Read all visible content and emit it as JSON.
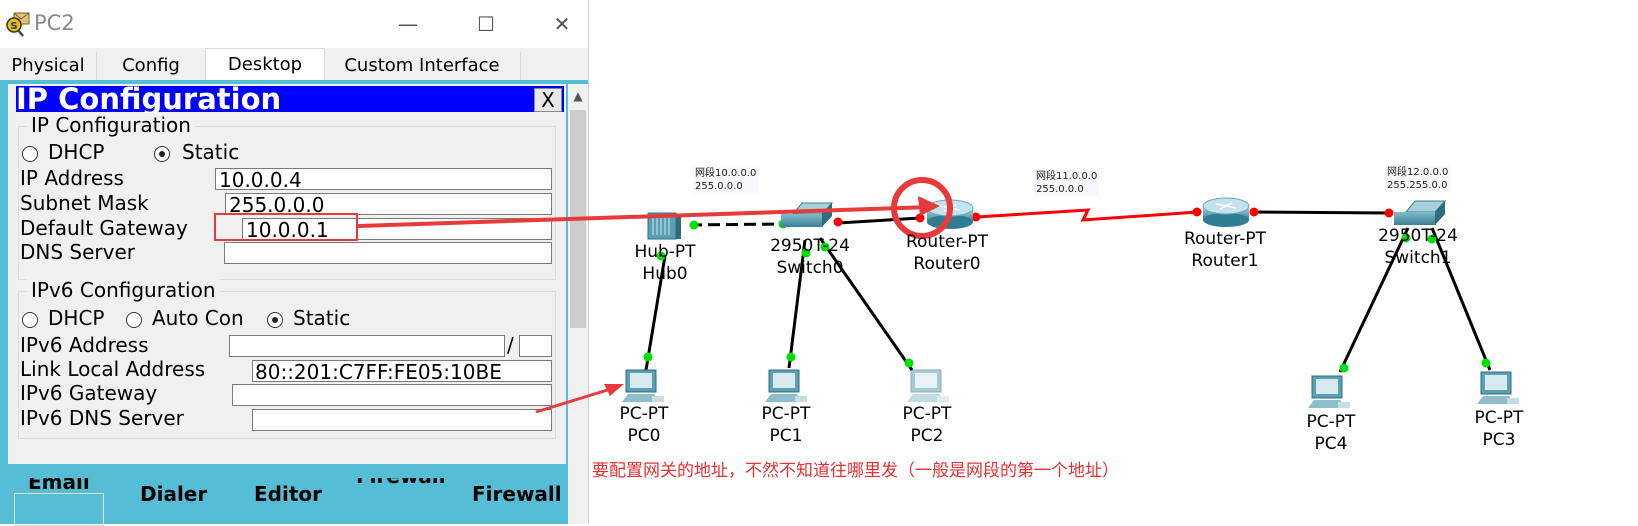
{
  "window": {
    "title": "PC2",
    "controls": {
      "minimize": "—",
      "maximize": "☐",
      "close": "✕"
    }
  },
  "tabs": [
    {
      "label": "Physical",
      "active": false
    },
    {
      "label": "Config",
      "active": false
    },
    {
      "label": "Desktop",
      "active": true
    },
    {
      "label": "Custom Interface",
      "active": false
    }
  ],
  "ip_config": {
    "title": "IP Configuration",
    "close_label": "X",
    "ipv4": {
      "group_label": "IP Configuration",
      "dhcp_label": "DHCP",
      "static_label": "Static",
      "mode": "Static",
      "ip_address_label": "IP Address",
      "ip_address": "10.0.0.4",
      "subnet_mask_label": "Subnet Mask",
      "subnet_mask": "255.0.0.0",
      "default_gateway_label": "Default Gateway",
      "default_gateway": "10.0.0.1",
      "dns_server_label": "DNS Server",
      "dns_server": ""
    },
    "ipv6": {
      "group_label": "IPv6 Configuration",
      "dhcp_label": "DHCP",
      "auto_label": "Auto Con",
      "static_label": "Static",
      "mode": "Static",
      "address_label": "IPv6 Address",
      "address": "",
      "prefix_sep": "/",
      "prefix": "",
      "link_local_label": "Link Local Address",
      "link_local": "80::201:C7FF:FE05:10BE",
      "gateway_label": "IPv6 Gateway",
      "gateway": "",
      "dns_label": "IPv6 DNS Server",
      "dns": ""
    }
  },
  "desktop_apps": [
    "Email",
    "Dialer",
    "Editor",
    "Firewall",
    "Firewall"
  ],
  "scrollbar": {
    "up_icon": "chevron-up-icon"
  },
  "topology": {
    "notes": [
      {
        "line1": "网段10.0.0.0",
        "line2": "255.0.0.0"
      },
      {
        "line1": "网段11.0.0.0",
        "line2": "255.0.0.0"
      },
      {
        "line1": "网段12.0.0.0",
        "line2": "255.255.0.0"
      }
    ],
    "devices": [
      {
        "type": "Hub-PT",
        "name": "Hub0",
        "icon": "hub-icon"
      },
      {
        "type": "2950T-24",
        "name": "Switch0",
        "icon": "switch-icon"
      },
      {
        "type": "Router-PT",
        "name": "Router0",
        "icon": "router-icon"
      },
      {
        "type": "Router-PT",
        "name": "Router1",
        "icon": "router-icon"
      },
      {
        "type": "2950T-24",
        "name": "Switch1",
        "icon": "switch-icon"
      },
      {
        "type": "PC-PT",
        "name": "PC0",
        "icon": "pc-icon"
      },
      {
        "type": "PC-PT",
        "name": "PC1",
        "icon": "pc-icon"
      },
      {
        "type": "PC-PT",
        "name": "PC2",
        "icon": "pc-icon"
      },
      {
        "type": "PC-PT",
        "name": "PC4",
        "icon": "pc-icon"
      },
      {
        "type": "PC-PT",
        "name": "PC3",
        "icon": "pc-icon"
      }
    ],
    "colors": {
      "link_up": "#00e000",
      "link_down": "#ff0000",
      "serial": "#ff0000",
      "annotation": "#e83a3a"
    }
  },
  "annotation": "要配置网关的地址，不然不知道往哪里发（一般是网段的第一个地址）"
}
